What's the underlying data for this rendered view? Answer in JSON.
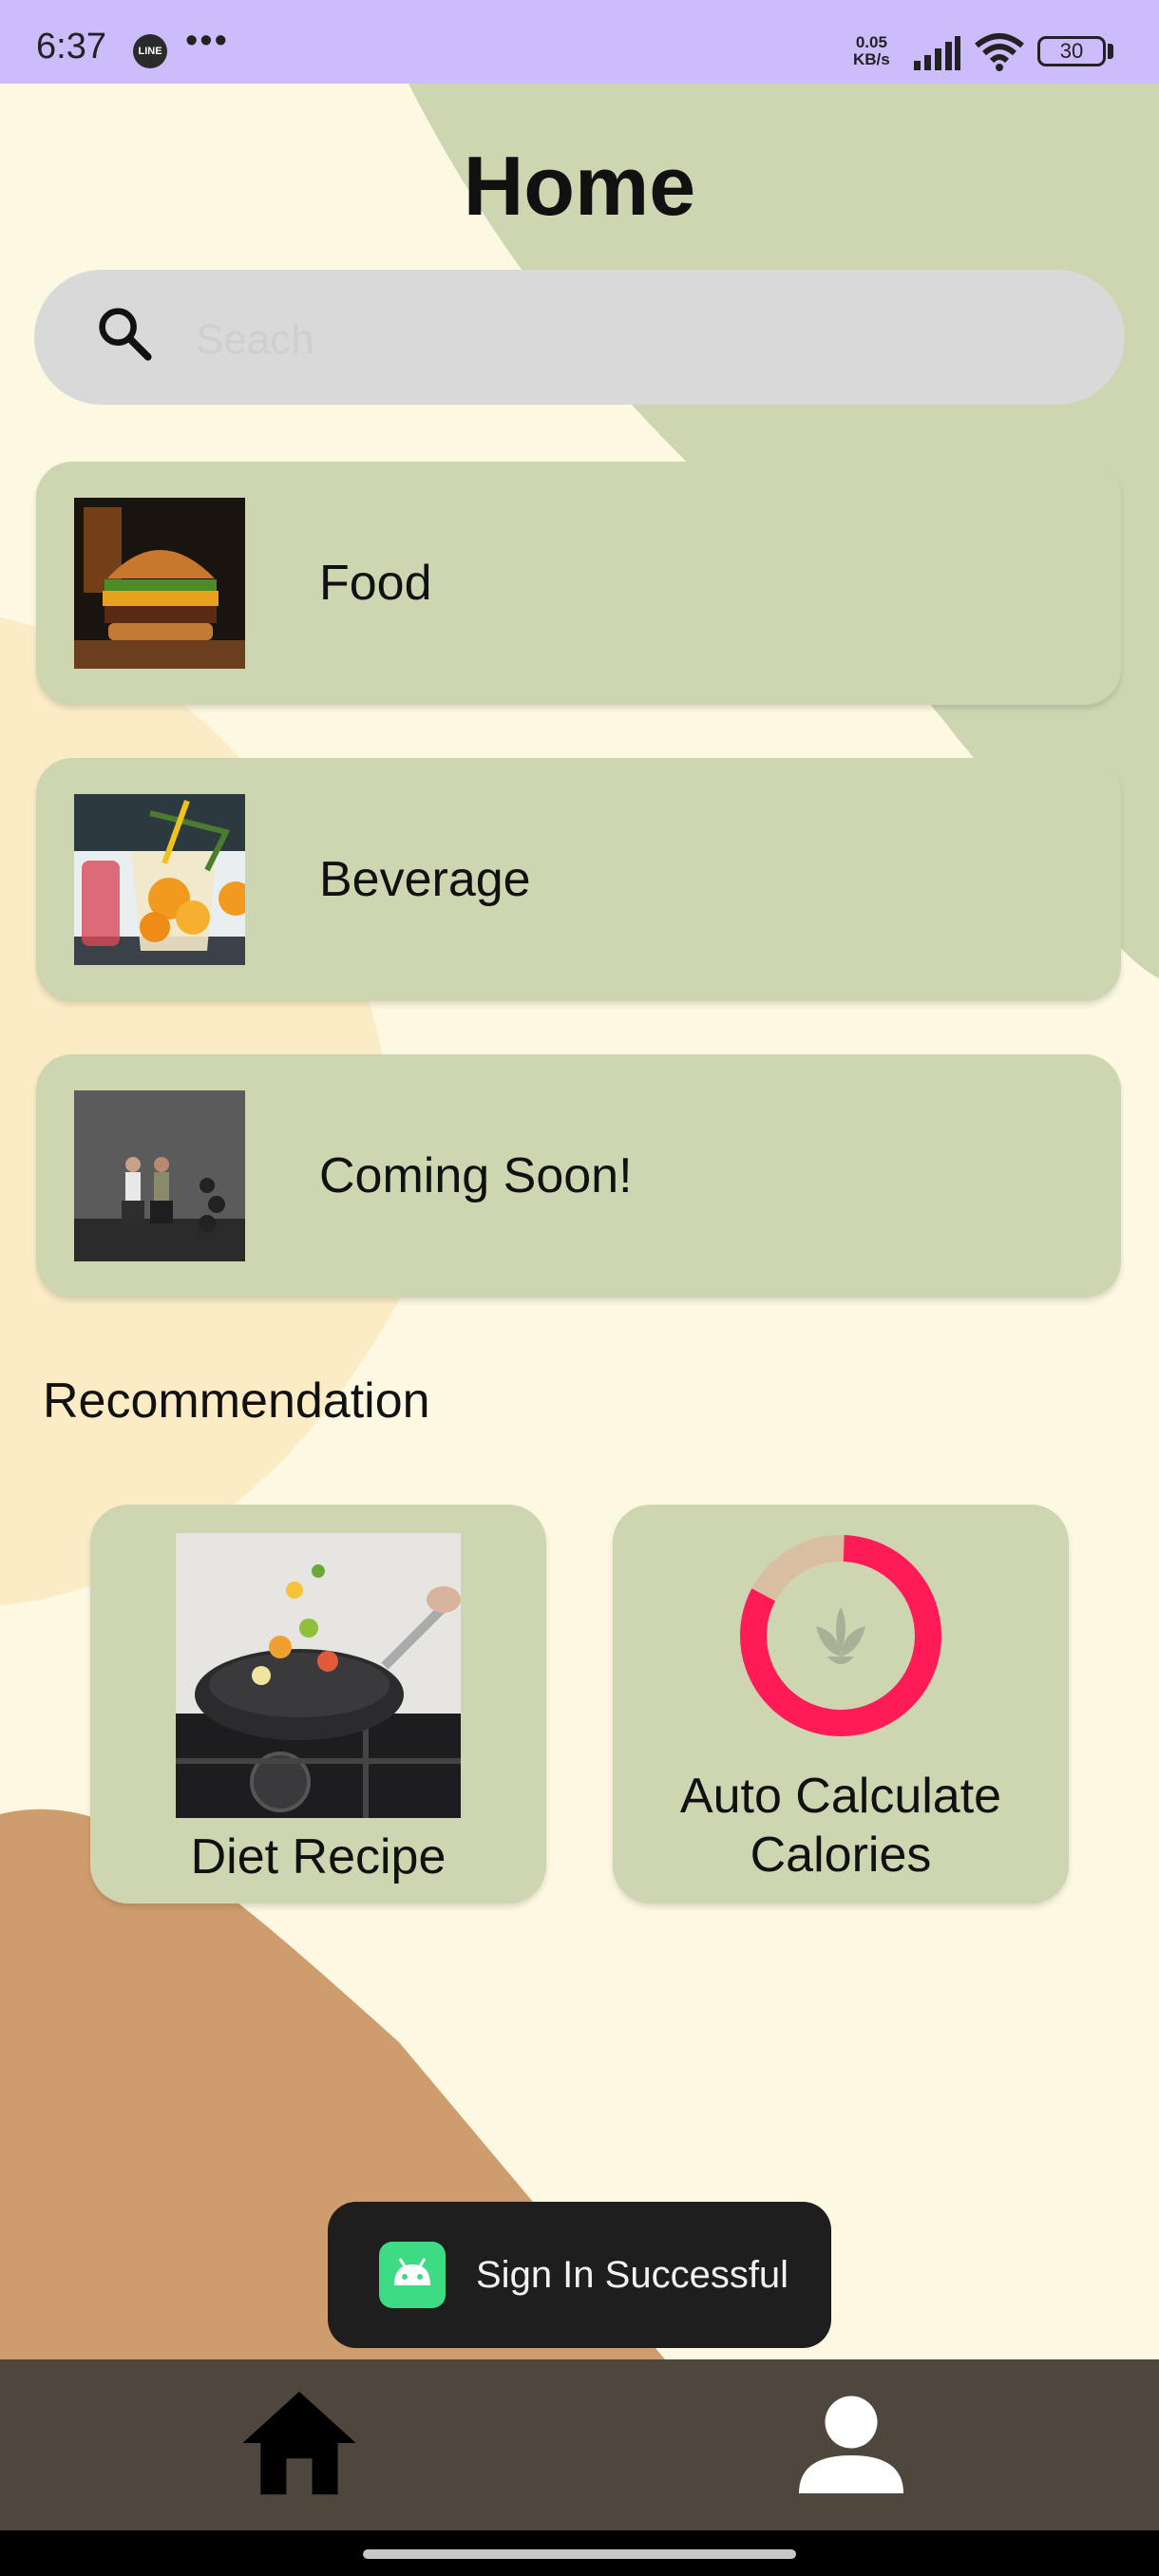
{
  "status_bar": {
    "time": "6:37",
    "notification_icon": "LINE",
    "more": "•••",
    "net_speed_value": "0.05",
    "net_speed_unit": "KB/s",
    "battery": "30",
    "icons": [
      "signal-icon",
      "wifi-icon",
      "battery-icon"
    ]
  },
  "header": {
    "title": "Home"
  },
  "search": {
    "placeholder": "Seach",
    "value": ""
  },
  "categories": [
    {
      "label": "Food",
      "image": "burger-image"
    },
    {
      "label": "Beverage",
      "image": "drink-image"
    },
    {
      "label": "Coming Soon!",
      "image": "workout-image"
    }
  ],
  "recommendation": {
    "heading": "Recommendation",
    "cards": [
      {
        "label": "Diet Recipe",
        "image": "pan-cooking-image"
      },
      {
        "label_line1": "Auto Calculate",
        "label_line2": "Calories",
        "image": "calorie-ring-icon"
      }
    ]
  },
  "toast": {
    "text": "Sign In Successful",
    "icon": "android-icon"
  },
  "bottom_nav": {
    "items": [
      "home-icon",
      "profile-icon"
    ]
  },
  "colors": {
    "background": "#fdf8e1",
    "card": "#ced5b1",
    "status_bar": "#cdbcfb",
    "nav_bar": "#4f463d",
    "ring_accent": "#ff1b55"
  }
}
